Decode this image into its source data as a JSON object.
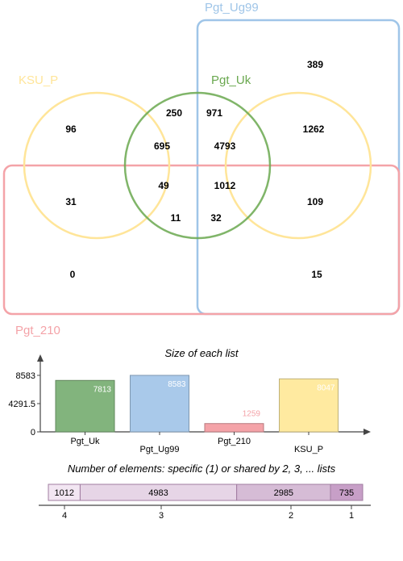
{
  "venn": {
    "sets": [
      {
        "key": "ug99",
        "name": "Pgt_Ug99",
        "color": "#9fc5e8"
      },
      {
        "key": "ksu",
        "name": "KSU_P",
        "color": "#ffe599"
      },
      {
        "key": "uk",
        "name": "Pgt_Uk",
        "color": "#6aa84f"
      },
      {
        "key": "p210",
        "name": "Pgt_210",
        "color": "#f4a3a8"
      }
    ],
    "regions": [
      {
        "id": "ug99-only",
        "value": "389"
      },
      {
        "id": "ksu-left-only",
        "value": "96"
      },
      {
        "id": "ksu-left-uk",
        "value": "250"
      },
      {
        "id": "ksu-right-uk-ug99",
        "value": "971"
      },
      {
        "id": "ksu-right-ug99",
        "value": "1262"
      },
      {
        "id": "uk-only",
        "value": "695"
      },
      {
        "id": "uk-ug99",
        "value": "4793"
      },
      {
        "id": "ksu-left-p210",
        "value": "31"
      },
      {
        "id": "uk-p210",
        "value": "49"
      },
      {
        "id": "uk-ug99-p210",
        "value": "1012"
      },
      {
        "id": "ksu-right-ug99-p210",
        "value": "109"
      },
      {
        "id": "ksu-left-uk-p210",
        "value": "11"
      },
      {
        "id": "ksu-right-uk-ug99-p210",
        "value": "32"
      },
      {
        "id": "p210-only",
        "value": "0"
      },
      {
        "id": "ug99-p210",
        "value": "15"
      }
    ]
  },
  "chart_data": [
    {
      "type": "bar",
      "title": "Size of each list",
      "categories": [
        "Pgt_Uk",
        "Pgt_Ug99",
        "Pgt_210",
        "KSU_P"
      ],
      "values": [
        7813,
        8583,
        1259,
        8047
      ],
      "value_labels": [
        "7813",
        "8583",
        "1259",
        "8047"
      ],
      "colors": [
        "#82b47d",
        "#a9c9ea",
        "#f4a3a8",
        "#ffeaa0"
      ],
      "ytick_labels": [
        "0",
        "4291.5",
        "8583"
      ],
      "ylim": [
        0,
        8583
      ]
    },
    {
      "type": "bar",
      "title": "Number of elements: specific (1) or shared by 2, 3, ... lists",
      "categories": [
        "4",
        "3",
        "2",
        "1"
      ],
      "values": [
        1012,
        4983,
        2985,
        735
      ],
      "value_labels": [
        "1012",
        "4983",
        "2985",
        "735"
      ],
      "colors": [
        "#f2e6f2",
        "#e6d5e6",
        "#d6bcd6",
        "#c79fc7"
      ]
    }
  ]
}
